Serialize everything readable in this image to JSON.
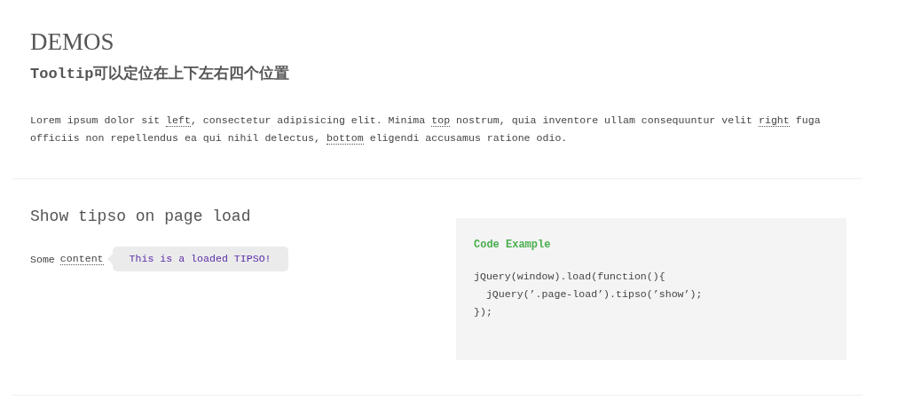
{
  "page_title": "DEMOS",
  "subtitle": "Tooltip可以定位在上下左右四个位置",
  "intro": [
    {
      "kind": "text",
      "text": "Lorem ipsum dolor sit "
    },
    {
      "kind": "link",
      "text": "left"
    },
    {
      "kind": "text",
      "text": ", consectetur adipisicing elit. Minima "
    },
    {
      "kind": "link",
      "text": "top"
    },
    {
      "kind": "text",
      "text": " nostrum, quia inventore ullam consequuntur velit "
    },
    {
      "kind": "link",
      "text": "right"
    },
    {
      "kind": "text",
      "text": " fuga officiis non repellendus ea qui nihil delectus, "
    },
    {
      "kind": "link",
      "text": "bottom"
    },
    {
      "kind": "text",
      "text": " eligendi accusamus ratione odio."
    }
  ],
  "demo": {
    "title": "Show tipso on page load",
    "label": "Some",
    "link": "content",
    "tooltip": "This is a loaded TIPSO!"
  },
  "code": {
    "title": "Code Example",
    "lines": [
      "jQuery(window).load(function(){",
      "  jQuery(’.page-load’).tipso(’show’);",
      "});"
    ]
  }
}
